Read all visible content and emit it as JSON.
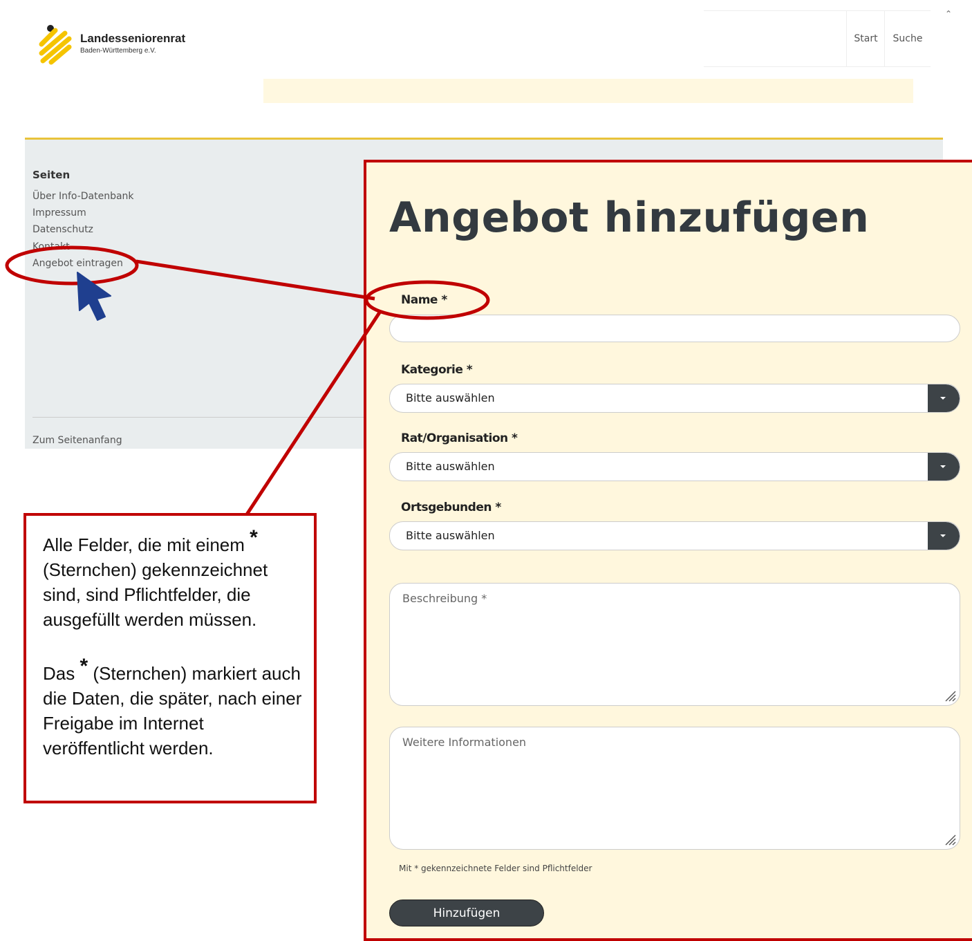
{
  "brand": {
    "name": "Landesseniorenrat",
    "subtitle": "Baden-Württemberg e.V."
  },
  "nav": {
    "start": "Start",
    "search": "Suche"
  },
  "sidebar": {
    "title": "Seiten",
    "links": [
      "Über Info-Datenbank",
      "Impressum",
      "Datenschutz",
      "Kontakt",
      "Angebot eintragen"
    ],
    "back_to_top": "Zum Seitenanfang"
  },
  "form": {
    "title": "Angebot hinzufügen",
    "name_label": "Name *",
    "category_label": "Kategorie *",
    "category_value": "Bitte auswählen",
    "organization_label": "Rat/Organisation *",
    "organization_value": "Bitte auswählen",
    "local_label": "Ortsgebunden *",
    "local_value": "Bitte auswählen",
    "description_placeholder": "Beschreibung *",
    "info_placeholder": "Weitere Informationen",
    "required_note": "Mit * gekennzeichnete Felder sind Pflichtfelder",
    "submit_label": "Hinzufügen"
  },
  "callout": {
    "p1_a": "Alle Felder, die mit einem",
    "star": "*",
    "p1_b": "(Sternchen) gekennzeichnet sind, sind Pflichtfelder, die ausgefüllt werden müssen.",
    "p2_a": "Das",
    "p2_b": "(Sternchen) markiert auch die Daten, die später, nach einer Freigabe im Internet veröffentlicht werden."
  },
  "colors": {
    "annotation_red": "#c00000",
    "cursor_blue": "#1f3f8f",
    "brand_yellow": "#f5c400",
    "form_bg": "#fff7dd",
    "dark_button": "#3d4347"
  }
}
